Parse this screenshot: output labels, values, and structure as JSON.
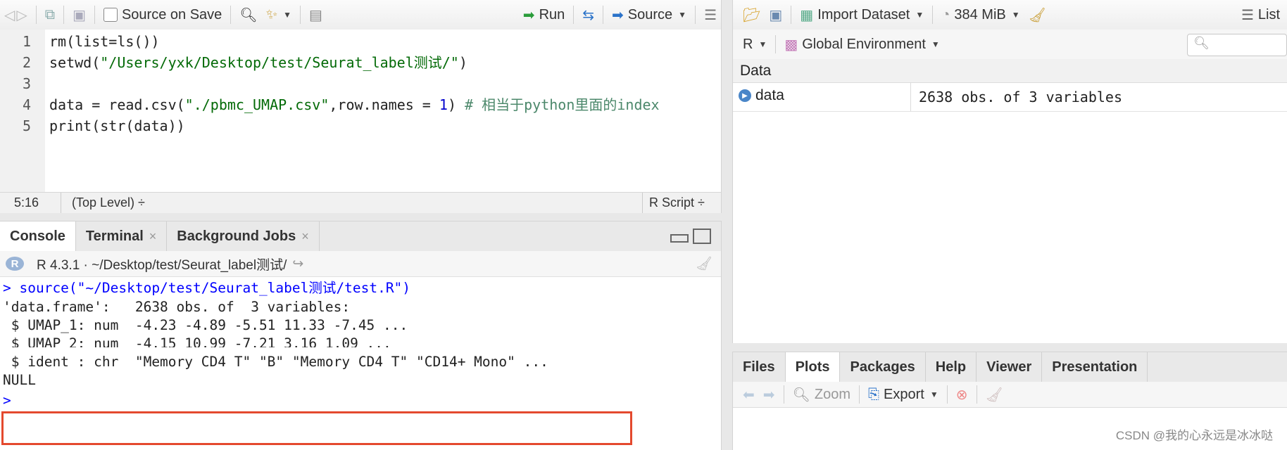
{
  "editor": {
    "toolbar": {
      "source_on_save": "Source on Save",
      "run": "Run",
      "source": "Source"
    },
    "lines": [
      {
        "num": "1",
        "segments": [
          {
            "t": "rm(list=ls())",
            "c": "kw"
          }
        ]
      },
      {
        "num": "2",
        "segments": [
          {
            "t": "setwd(",
            "c": "kw"
          },
          {
            "t": "\"/Users/yxk/Desktop/test/Seurat_label测试/\"",
            "c": "str"
          },
          {
            "t": ")",
            "c": "kw"
          }
        ]
      },
      {
        "num": "3",
        "segments": []
      },
      {
        "num": "4",
        "segments": [
          {
            "t": "data = read.csv(",
            "c": "kw"
          },
          {
            "t": "\"./pbmc_UMAP.csv\"",
            "c": "str"
          },
          {
            "t": ",row.names = ",
            "c": "kw"
          },
          {
            "t": "1",
            "c": "num"
          },
          {
            "t": ") ",
            "c": "kw"
          },
          {
            "t": "# 相当于python里面的index",
            "c": "com"
          }
        ]
      },
      {
        "num": "5",
        "segments": [
          {
            "t": "print(str(data))",
            "c": "kw"
          }
        ]
      }
    ],
    "status": {
      "position": "5:16",
      "scope": "(Top Level) ÷",
      "filetype": "R Script ÷"
    }
  },
  "console": {
    "tabs": [
      {
        "label": "Console",
        "active": true,
        "closable": false
      },
      {
        "label": "Terminal",
        "active": false,
        "closable": true
      },
      {
        "label": "Background Jobs",
        "active": false,
        "closable": true
      }
    ],
    "info": "R 4.3.1 · ~/Desktop/test/Seurat_label测试/",
    "output": [
      {
        "text": "> source(\"~/Desktop/test/Seurat_label测试/test.R\")",
        "kind": "prompt"
      },
      {
        "text": "'data.frame':   2638 obs. of  3 variables:",
        "kind": "out"
      },
      {
        "text": " $ UMAP_1: num  -4.23 -4.89 -5.51 11.33 -7.45 ...",
        "kind": "out"
      },
      {
        "text": " $ UMAP_2: num  -4.15 10.99 -7.21 3.16 1.09 ...",
        "kind": "out"
      },
      {
        "text": " $ ident : chr  \"Memory CD4 T\" \"B\" \"Memory CD4 T\" \"CD14+ Mono\" ...",
        "kind": "out"
      },
      {
        "text": "NULL",
        "kind": "out"
      },
      {
        "text": "> ",
        "kind": "prompt"
      }
    ]
  },
  "environment": {
    "toolbar": {
      "import_dataset": "Import Dataset",
      "memory": "384 MiB",
      "view_mode": "List"
    },
    "language": "R",
    "scope": "Global Environment",
    "section": "Data",
    "rows": [
      {
        "name": "data",
        "value": "2638 obs. of 3 variables"
      }
    ]
  },
  "plots": {
    "tabs": [
      "Files",
      "Plots",
      "Packages",
      "Help",
      "Viewer",
      "Presentation"
    ],
    "active_tab": "Plots",
    "toolbar": {
      "zoom": "Zoom",
      "export": "Export"
    }
  },
  "watermark": "CSDN @我的心永远是冰冰哒",
  "colors": {
    "highlight": "#e4492e",
    "string": "#036a07",
    "number": "#0000cd",
    "comment": "#4c886b",
    "prompt": "#0000ff"
  }
}
